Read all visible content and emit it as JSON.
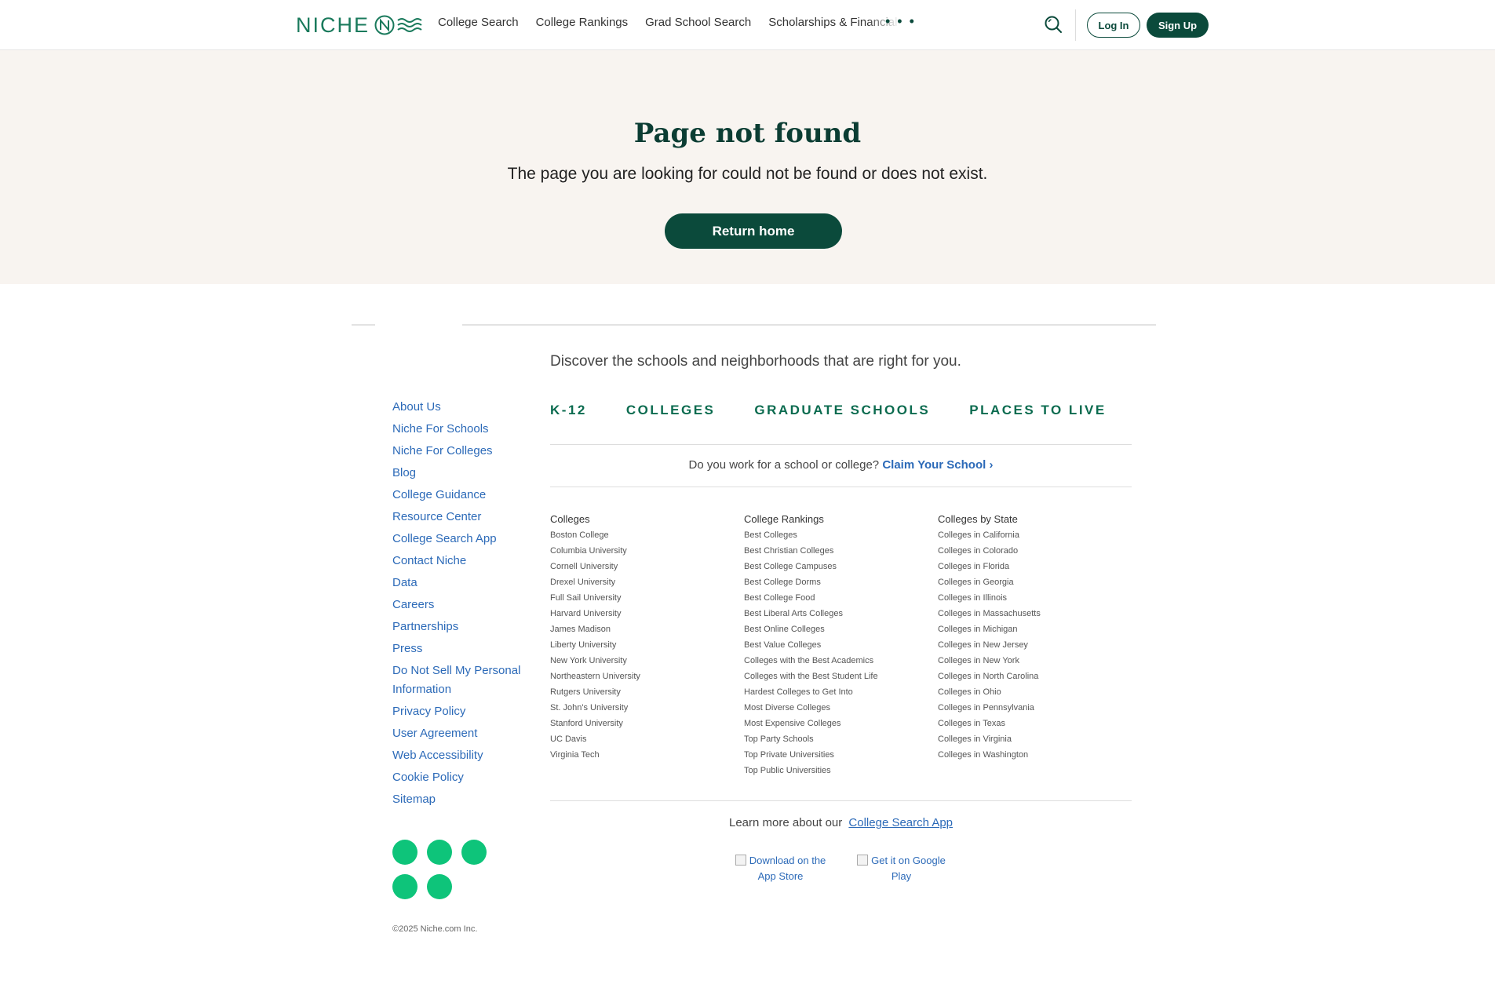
{
  "header": {
    "logo_text": "NICHE",
    "nav": [
      "College Search",
      "College Rankings",
      "Grad School Search",
      "Scholarships & Financial Aid"
    ],
    "more_label": "• • •",
    "login_label": "Log In",
    "signup_label": "Sign Up"
  },
  "hero": {
    "title": "Page not found",
    "message": "The page you are looking for could not be found or does not exist.",
    "button_label": "Return home"
  },
  "footer": {
    "tagline": "Discover the schools and neighborhoods that are right for you.",
    "links": [
      "About Us",
      "Niche For Schools",
      "Niche For Colleges",
      "Blog",
      "College Guidance",
      "Resource Center",
      "College Search App",
      "Contact Niche",
      "Data",
      "Careers",
      "Partnerships",
      "Press",
      "Do Not Sell My Personal Information",
      "Privacy Policy",
      "User Agreement",
      "Web Accessibility",
      "Cookie Policy",
      "Sitemap"
    ],
    "verticals": [
      "K-12",
      "COLLEGES",
      "GRADUATE SCHOOLS",
      "PLACES TO LIVE"
    ],
    "claim_prompt": "Do you work for a school or college?",
    "claim_link": "Claim Your School",
    "columns": [
      {
        "heading": "Colleges",
        "items": [
          "Boston College",
          "Columbia University",
          "Cornell University",
          "Drexel University",
          "Full Sail University",
          "Harvard University",
          "James Madison",
          "Liberty University",
          "New York University",
          "Northeastern University",
          "Rutgers University",
          "St. John's University",
          "Stanford University",
          "UC Davis",
          "Virginia Tech"
        ]
      },
      {
        "heading": "College Rankings",
        "items": [
          "Best Colleges",
          "Best Christian Colleges",
          "Best College Campuses",
          "Best College Dorms",
          "Best College Food",
          "Best Liberal Arts Colleges",
          "Best Online Colleges",
          "Best Value Colleges",
          "Colleges with the Best Academics",
          "Colleges with the Best Student Life",
          "Hardest Colleges to Get Into",
          "Most Diverse Colleges",
          "Most Expensive Colleges",
          "Top Party Schools",
          "Top Private Universities",
          "Top Public Universities"
        ]
      },
      {
        "heading": "Colleges by State",
        "items": [
          "Colleges in California",
          "Colleges in Colorado",
          "Colleges in Florida",
          "Colleges in Georgia",
          "Colleges in Illinois",
          "Colleges in Massachusetts",
          "Colleges in Michigan",
          "Colleges in New Jersey",
          "Colleges in New York",
          "Colleges in North Carolina",
          "Colleges in Ohio",
          "Colleges in Pennsylvania",
          "Colleges in Texas",
          "Colleges in Virginia",
          "Colleges in Washington"
        ]
      }
    ],
    "learn_prompt": "Learn more about our",
    "learn_link": "College Search App",
    "app_store_alt": "Download on the App Store",
    "google_play_alt": "Get it on Google Play",
    "copyright": "©2025 Niche.com Inc."
  },
  "colors": {
    "brand_dark": "#0b4a3b",
    "brand_green": "#1a7a5c",
    "link_blue": "#2c6ab8",
    "social_green": "#0ec47a",
    "hero_bg": "#f8f4f0"
  }
}
